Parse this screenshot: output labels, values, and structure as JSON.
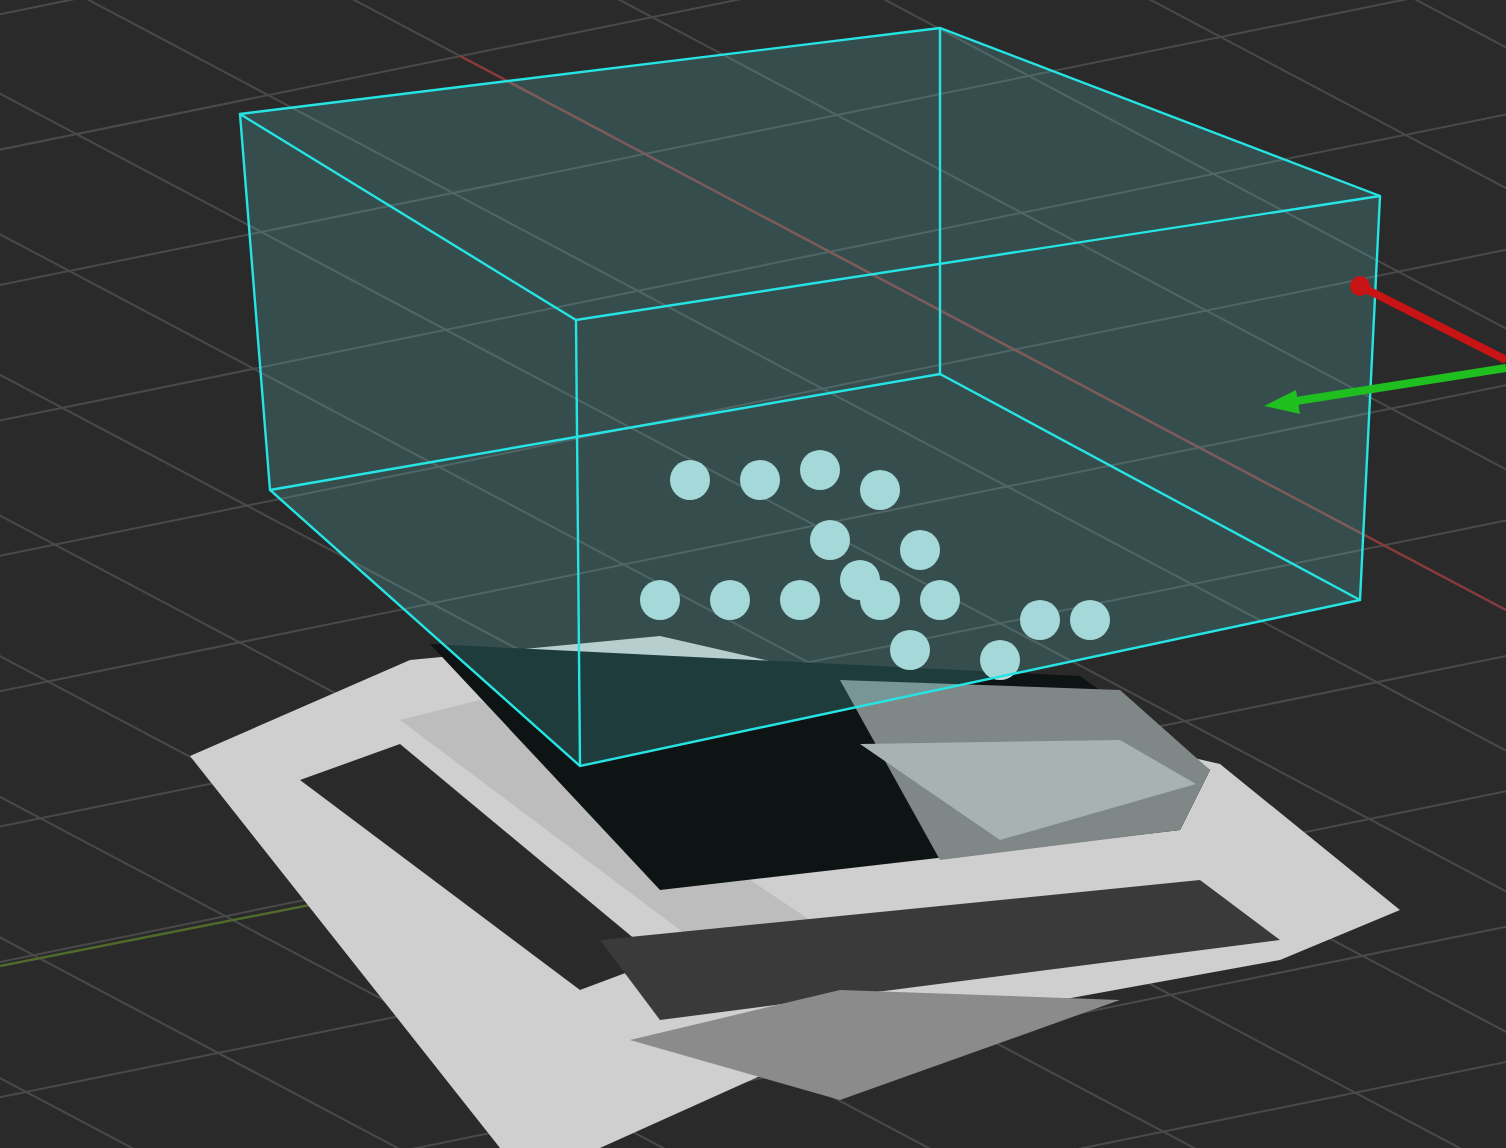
{
  "gizmo_arrows": [
    {
      "color": "#c81414"
    },
    {
      "color": "#1fbf1f"
    }
  ]
}
